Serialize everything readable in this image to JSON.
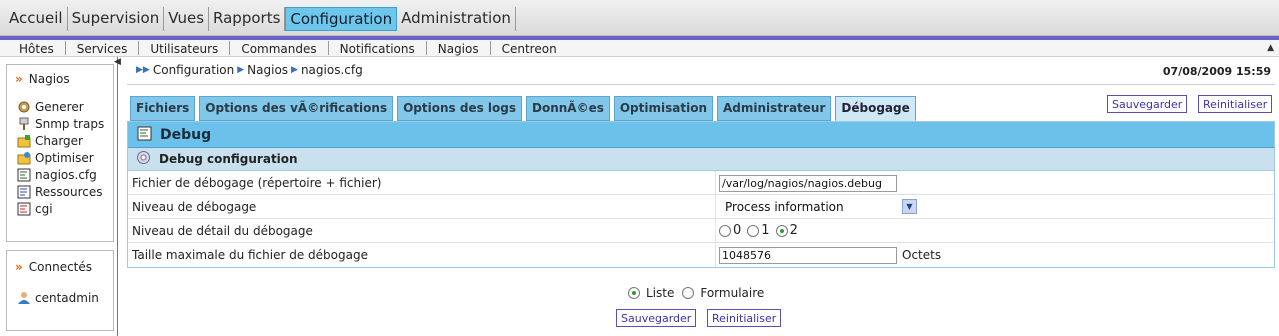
{
  "top_menu": [
    "Accueil",
    "Supervision",
    "Vues",
    "Rapports",
    "Configuration",
    "Administration"
  ],
  "top_menu_active": "Configuration",
  "sub_menu": [
    "Hôtes",
    "Services",
    "Utilisateurs",
    "Commandes",
    "Notifications",
    "Nagios",
    "Centreon"
  ],
  "sidebar": {
    "section1_title": "Nagios",
    "items": [
      "Generer",
      "Snmp traps",
      "Charger",
      "Optimiser",
      "nagios.cfg",
      "Ressources",
      "cgi"
    ],
    "section2_title": "Connectés",
    "user": "centadmin"
  },
  "breadcrumb": [
    "Configuration",
    "Nagios",
    "nagios.cfg"
  ],
  "datetime": "07/08/2009 15:59",
  "tabs": [
    "Fichiers",
    "Options des vÃ©rifications",
    "Options des logs",
    "DonnÃ©es",
    "Optimisation",
    "Administrateur",
    "Débogage"
  ],
  "active_tab": "Débogage",
  "buttons": {
    "save": "Sauvegarder",
    "reset": "Reinitialiser"
  },
  "panel": {
    "title": "Debug",
    "subtitle": "Debug configuration",
    "fields": {
      "file_label": "Fichier de débogage (répertoire + fichier)",
      "file_value": "/var/log/nagios/nagios.debug",
      "level_label": "Niveau de débogage",
      "level_value": "Process information",
      "verbosity_label": "Niveau de détail du débogage",
      "verbosity_options": [
        "0",
        "1",
        "2"
      ],
      "verbosity_selected": "2",
      "maxsize_label": "Taille maximale du fichier de débogage",
      "maxsize_value": "1048576",
      "maxsize_unit": "Octets"
    }
  },
  "view_mode": {
    "options": [
      "Liste",
      "Formulaire"
    ],
    "selected": "Liste"
  },
  "colors": {
    "tab": "#80c7ea",
    "header": "#6cc1ea",
    "accent_bar": "#6a62c8",
    "chevron": "#e06a1a"
  }
}
